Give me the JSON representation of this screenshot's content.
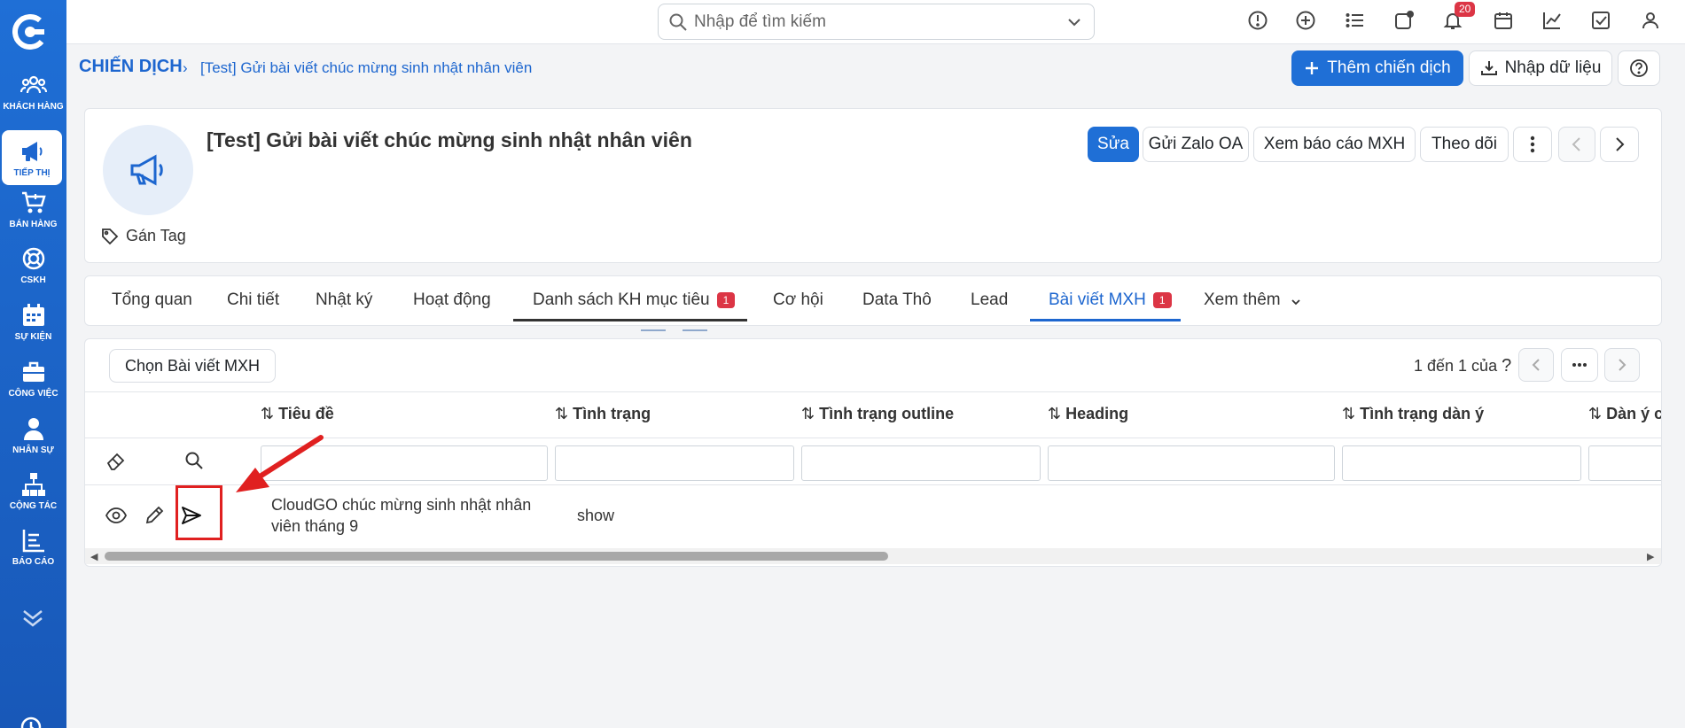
{
  "sidebar": {
    "items": [
      {
        "label": "KHÁCH HÀNG",
        "icon": "users-icon"
      },
      {
        "label": "TIẾP THỊ",
        "icon": "megaphone-icon"
      },
      {
        "label": "BÁN HÀNG",
        "icon": "cart-icon"
      },
      {
        "label": "CSKH",
        "icon": "lifebuoy-icon"
      },
      {
        "label": "SỰ KIỆN",
        "icon": "calendar-icon"
      },
      {
        "label": "CÔNG VIỆC",
        "icon": "briefcase-icon"
      },
      {
        "label": "NHÂN SỰ",
        "icon": "person-icon"
      },
      {
        "label": "CỘNG TÁC",
        "icon": "hierarchy-icon"
      },
      {
        "label": "BÁO CÁO",
        "icon": "report-icon"
      }
    ],
    "active_index": 1
  },
  "topbar": {
    "search_placeholder": "Nhập để tìm kiếm",
    "notification_count": "20"
  },
  "breadcrumb": {
    "root": "CHIẾN DỊCH",
    "current": "[Test] Gửi bài viết chúc mừng sinh nhật nhân viên"
  },
  "actions": {
    "add_campaign": "Thêm chiến dịch",
    "import_data": "Nhập dữ liệu"
  },
  "record": {
    "title": "[Test] Gửi bài viết chúc mừng sinh nhật nhân viên",
    "tag_label": "Gán Tag",
    "buttons": {
      "edit": "Sửa",
      "send_zalo": "Gửi Zalo OA",
      "view_report": "Xem báo cáo MXH",
      "follow": "Theo dõi"
    }
  },
  "tabs": [
    {
      "label": "Tổng quan"
    },
    {
      "label": "Chi tiết"
    },
    {
      "label": "Nhật ký"
    },
    {
      "label": "Hoạt động"
    },
    {
      "label": "Danh sách KH mục tiêu",
      "count": "1"
    },
    {
      "label": "Cơ hội"
    },
    {
      "label": "Data Thô"
    },
    {
      "label": "Lead"
    },
    {
      "label": "Bài viết MXH",
      "count": "1"
    },
    {
      "label": "Xem thêm"
    }
  ],
  "active_tab": 8,
  "grid": {
    "select_button": "Chọn Bài viết MXH",
    "pager_text": "1 đến 1 của",
    "pager_suffix": "?",
    "columns": [
      "Tiêu đề",
      "Tình trạng",
      "Tình trạng outline",
      "Heading",
      "Tình trạng dàn ý",
      "Dàn ý c"
    ],
    "rows": [
      {
        "title": "CloudGO chúc mừng sinh nhật nhân viên tháng 9",
        "status": "show"
      }
    ]
  },
  "colors": {
    "accent": "#1f6fd6",
    "rail": "#1d64c8",
    "badge": "#dc3545",
    "annotation": "#e02020"
  }
}
